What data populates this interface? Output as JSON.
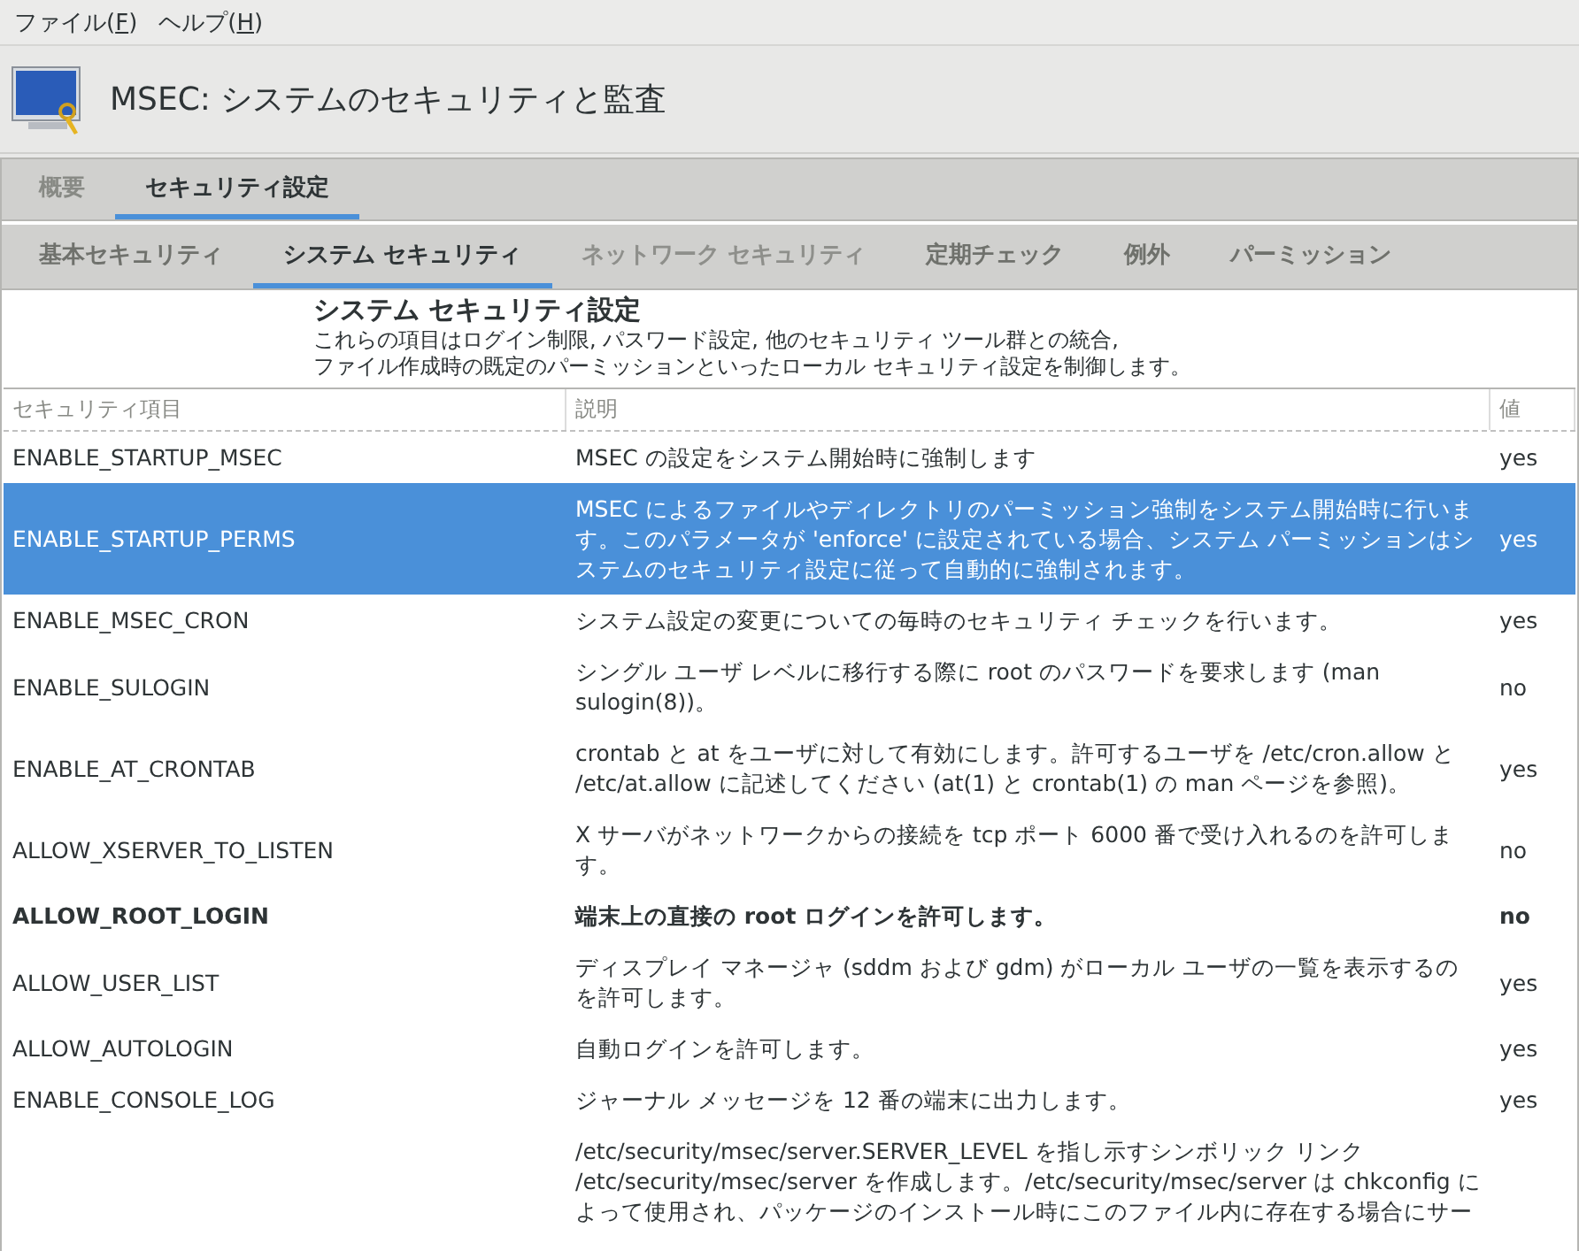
{
  "menu": [
    {
      "label": "ファイル(",
      "mnemonic": "F",
      "tail": ")"
    },
    {
      "label": "ヘルプ(",
      "mnemonic": "H",
      "tail": ")"
    }
  ],
  "window": {
    "title": "MSEC: システムのセキュリティと監査"
  },
  "tabs": [
    {
      "label": "概要",
      "selected": false
    },
    {
      "label": "セキュリティ設定",
      "selected": true
    }
  ],
  "subtabs": [
    {
      "label": "基本セキュリティ",
      "selected": false,
      "disabled": false
    },
    {
      "label": "システム セキュリティ",
      "selected": true,
      "disabled": false
    },
    {
      "label": "ネットワーク セキュリティ",
      "selected": false,
      "disabled": true
    },
    {
      "label": "定期チェック",
      "selected": false,
      "disabled": false
    },
    {
      "label": "例外",
      "selected": false,
      "disabled": false
    },
    {
      "label": "パーミッション",
      "selected": false,
      "disabled": false
    }
  ],
  "section": {
    "heading": "システム セキュリティ設定",
    "lines": [
      "これらの項目はログイン制限, パスワード設定, 他のセキュリティ ツール群との統合,",
      "ファイル作成時の既定のパーミッションといったローカル セキュリティ設定を制御します。"
    ]
  },
  "table": {
    "columns": [
      "セキュリティ項目",
      "説明",
      "値"
    ],
    "rows": [
      {
        "key": "ENABLE_STARTUP_MSEC",
        "description": "MSEC の設定をシステム開始時に強制します",
        "value": "yes",
        "selected": false,
        "modified": false
      },
      {
        "key": "ENABLE_STARTUP_PERMS",
        "description": "MSEC によるファイルやディレクトリのパーミッション強制をシステム開始時に行います。このパラメータが 'enforce' に設定されている場合、システム パーミッションはシステムのセキュリティ設定に従って自動的に強制されます。",
        "value": "yes",
        "selected": true,
        "modified": false
      },
      {
        "key": "ENABLE_MSEC_CRON",
        "description": "システム設定の変更についての毎時のセキュリティ チェックを行います。",
        "value": "yes",
        "selected": false,
        "modified": false
      },
      {
        "key": "ENABLE_SULOGIN",
        "description": "シングル ユーザ レベルに移行する際に root のパスワードを要求します (man sulogin(8))。",
        "value": "no",
        "selected": false,
        "modified": false
      },
      {
        "key": "ENABLE_AT_CRONTAB",
        "description": "crontab と at をユーザに対して有効にします。許可するユーザを /etc/cron.allow と /etc/at.allow に記述してください (at(1) と crontab(1) の man ページを参照)。",
        "value": "yes",
        "selected": false,
        "modified": false
      },
      {
        "key": "ALLOW_XSERVER_TO_LISTEN",
        "description": "X サーバがネットワークからの接続を tcp ポート 6000 番で受け入れるのを許可します。",
        "value": "no",
        "selected": false,
        "modified": false
      },
      {
        "key": "ALLOW_ROOT_LOGIN",
        "description": "端末上の直接の root ログインを許可します。",
        "value": "no",
        "selected": false,
        "modified": true
      },
      {
        "key": "ALLOW_USER_LIST",
        "description": "ディスプレイ マネージャ (sddm および gdm) がローカル ユーザの一覧を表示するのを許可します。",
        "value": "yes",
        "selected": false,
        "modified": false
      },
      {
        "key": "ALLOW_AUTOLOGIN",
        "description": "自動ログインを許可します。",
        "value": "yes",
        "selected": false,
        "modified": false
      },
      {
        "key": "ENABLE_CONSOLE_LOG",
        "description": "ジャーナル メッセージを 12 番の端末に出力します。",
        "value": "yes",
        "selected": false,
        "modified": false
      },
      {
        "description": "/etc/security/msec/server.SERVER_LEVEL を指し示すシンボリック リンク /etc/security/msec/server を作成します。/etc/security/msec/server は chkconfig によって使用され、パッケージのインストール時にこのファイル内に存在する場合にサー",
        "selected": false,
        "modified": false
      }
    ]
  }
}
